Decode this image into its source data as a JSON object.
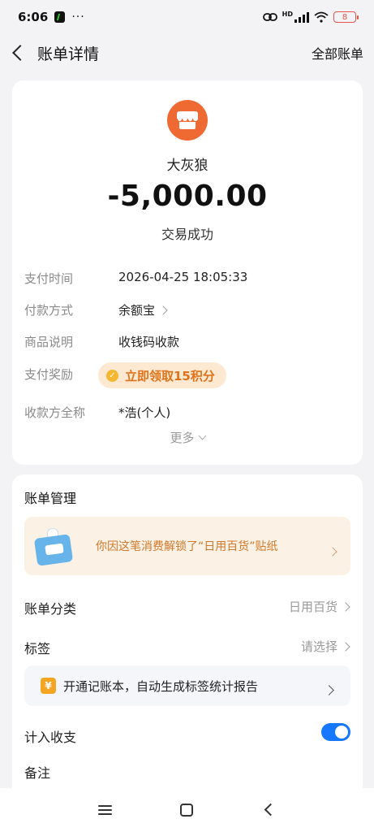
{
  "status_bar": {
    "time": "6:06",
    "dots": "···",
    "hd": "HD",
    "battery": "8"
  },
  "header": {
    "title": "账单详情",
    "right_action": "全部账单"
  },
  "transaction": {
    "merchant": "大灰狼",
    "amount": "-5,000.00",
    "status": "交易成功",
    "logo_color": "#ef6a32",
    "details": [
      {
        "label": "支付时间",
        "value": "2026-04-25 18:05:33"
      },
      {
        "label": "付款方式",
        "value": "余额宝"
      },
      {
        "label": "商品说明",
        "value": "收钱码收款"
      },
      {
        "label": "支付奖励",
        "value": "立即领取15积分"
      },
      {
        "label": "收款方全称",
        "value": "*浩(个人)"
      }
    ],
    "more_label": "更多"
  },
  "bill_management": {
    "title": "账单管理",
    "sticker_banner": "你因这笔消费解锁了“日用百货”贴纸",
    "category": {
      "label": "账单分类",
      "value": "日用百货"
    },
    "tag": {
      "label": "标签",
      "value": "请选择"
    },
    "ledger_banner": "开通记账本，自动生成标签统计报告",
    "include": {
      "label": "计入收支",
      "enabled": true
    },
    "remark": {
      "label": "备注"
    }
  },
  "colors": {
    "accent_blue": "#1677ff",
    "reward_orange": "#e0731a"
  }
}
